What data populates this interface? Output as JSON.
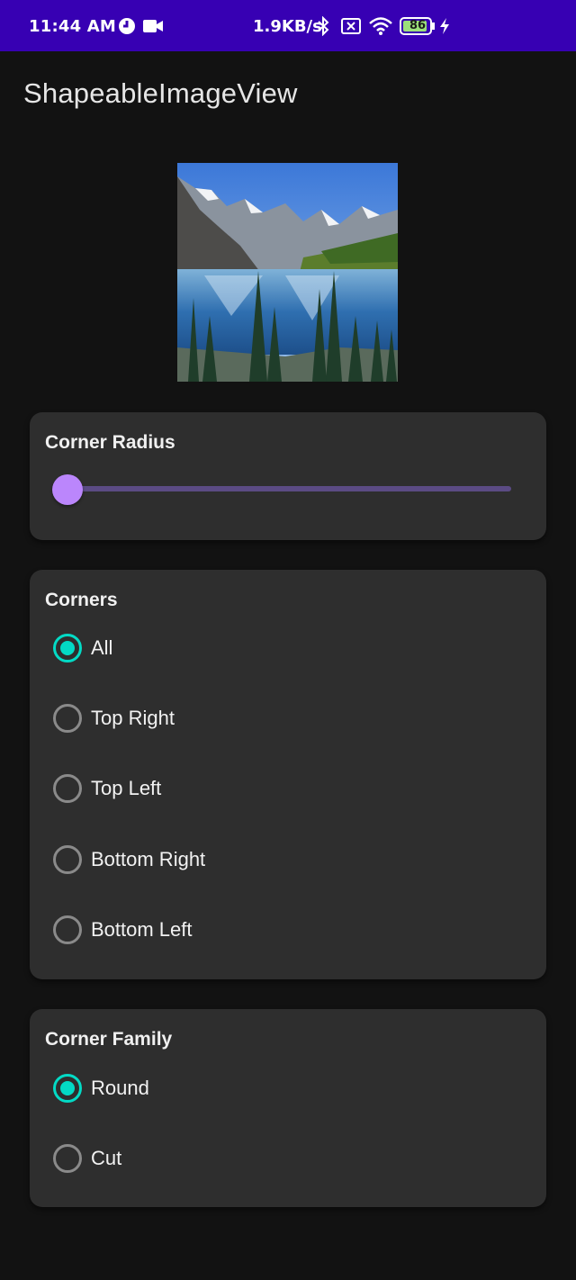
{
  "status_bar": {
    "time": "11:44 AM",
    "network_speed": "1.9KB/s",
    "battery_level": "86",
    "icons": [
      "clock-app-icon",
      "video-camera-icon",
      "bluetooth-icon",
      "sim-off-icon",
      "wifi-icon",
      "battery-icon",
      "charging-bolt-icon"
    ]
  },
  "app_bar": {
    "title": "ShapeableImageView"
  },
  "image": {
    "description_icon": "landscape-image"
  },
  "corner_radius_card": {
    "title": "Corner Radius",
    "slider_value": 0
  },
  "corners_card": {
    "title": "Corners",
    "options": [
      {
        "label": "All",
        "checked": true
      },
      {
        "label": "Top Right",
        "checked": false
      },
      {
        "label": "Top Left",
        "checked": false
      },
      {
        "label": "Bottom Right",
        "checked": false
      },
      {
        "label": "Bottom Left",
        "checked": false
      }
    ]
  },
  "corner_family_card": {
    "title": "Corner Family",
    "options": [
      {
        "label": "Round",
        "checked": true
      },
      {
        "label": "Cut",
        "checked": false
      }
    ]
  },
  "colors": {
    "status_bar": "#3700b3",
    "background": "#121212",
    "card": "#2e2e2e",
    "accent_radio": "#03dac5",
    "slider_thumb": "#bb86fc",
    "slider_track": "#5b4b84"
  }
}
